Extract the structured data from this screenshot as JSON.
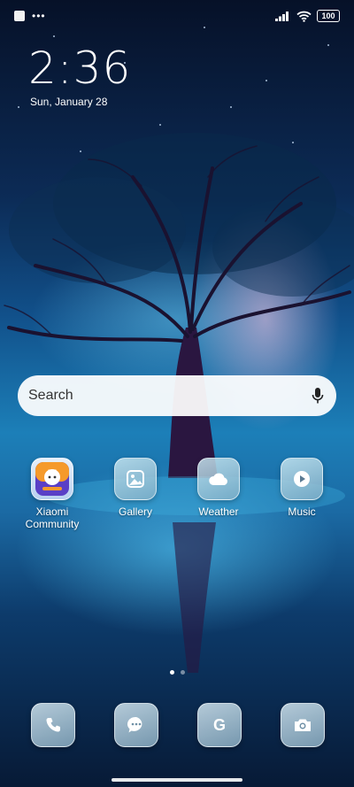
{
  "status_bar": {
    "notification_icons": [
      "app-notification-icon",
      "more-dots-icon"
    ],
    "more_dots": "•••",
    "signal_icon": "cell-signal-icon",
    "wifi_icon": "wifi-icon",
    "battery_level": "100"
  },
  "clock": {
    "time": "2:36",
    "date": "Sun, January 28"
  },
  "search": {
    "placeholder": "Search",
    "mic_icon": "microphone-icon"
  },
  "apps": [
    {
      "label": "Xiaomi Community",
      "icon": "xiaomi-community-icon"
    },
    {
      "label": "Gallery",
      "icon": "gallery-icon"
    },
    {
      "label": "Weather",
      "icon": "weather-icon"
    },
    {
      "label": "Music",
      "icon": "music-icon"
    }
  ],
  "pages": {
    "count": 2,
    "active": 0
  },
  "dock": [
    {
      "icon": "phone-icon"
    },
    {
      "icon": "messages-icon"
    },
    {
      "icon": "google-icon",
      "glyph": "G"
    },
    {
      "icon": "camera-icon"
    }
  ]
}
